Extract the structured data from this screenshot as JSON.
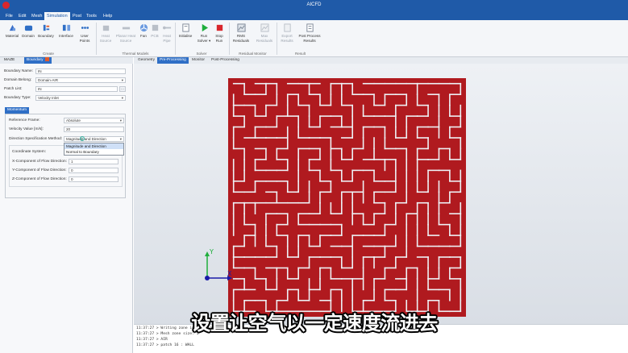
{
  "window": {
    "title": "AICFD"
  },
  "menu": [
    {
      "label": "File",
      "active": false
    },
    {
      "label": "Edit",
      "active": false
    },
    {
      "label": "Mesh",
      "active": false
    },
    {
      "label": "Simulation",
      "active": true
    },
    {
      "label": "Post",
      "active": false
    },
    {
      "label": "Tools",
      "active": false
    },
    {
      "label": "Help",
      "active": false
    }
  ],
  "ribbon": {
    "groups": [
      {
        "label": "Create",
        "buttons": [
          {
            "label": "Material",
            "icon": "material-icon",
            "enabled": true
          },
          {
            "label": "Domain",
            "icon": "domain-icon",
            "enabled": true
          },
          {
            "label": "Boundary",
            "icon": "boundary-icon",
            "enabled": true
          },
          {
            "label": "Interface",
            "icon": "interface-icon",
            "enabled": true
          },
          {
            "label": "User Points",
            "icon": "user-points-icon",
            "enabled": true
          }
        ]
      },
      {
        "label": "Thermal Models",
        "buttons": [
          {
            "label": "Heat Source",
            "icon": "heat-source-icon",
            "enabled": false
          },
          {
            "label": "Planar Heat Source",
            "icon": "planar-heat-source-icon",
            "enabled": false
          },
          {
            "label": "Fan",
            "icon": "fan-icon",
            "enabled": true
          },
          {
            "label": "PCB",
            "icon": "pcb-icon",
            "enabled": false
          },
          {
            "label": "Heat Pipe",
            "icon": "heat-pipe-icon",
            "enabled": false
          }
        ]
      },
      {
        "label": "Solver",
        "buttons": [
          {
            "label": "Initialise",
            "icon": "initialise-icon",
            "enabled": true
          },
          {
            "label": "Run Solver ▾",
            "icon": "run-solver-icon",
            "enabled": true
          },
          {
            "label": "Stop Run",
            "icon": "stop-run-icon",
            "enabled": true
          }
        ]
      },
      {
        "label": "Residual Monitor",
        "buttons": [
          {
            "label": "RMS Residuals",
            "icon": "rms-residuals-icon",
            "enabled": true
          },
          {
            "label": "Max Residuals",
            "icon": "max-residuals-icon",
            "enabled": false
          }
        ]
      },
      {
        "label": "Result",
        "buttons": [
          {
            "label": "Export Results",
            "icon": "export-results-icon",
            "enabled": false
          },
          {
            "label": "Post Process Results",
            "icon": "post-process-results-icon",
            "enabled": true
          }
        ]
      }
    ]
  },
  "left_panel": {
    "tabs": [
      {
        "label": "MAZE",
        "active": false
      },
      {
        "label": "Boundary",
        "active": true
      }
    ],
    "boundary_name": {
      "label": "Boundary Name:",
      "value": "IN"
    },
    "domain_belong": {
      "label": "Domain Belong:",
      "value": "Domain-AIR"
    },
    "patch_list": {
      "label": "Patch List:",
      "value": "IN",
      "button": "..."
    },
    "boundary_type": {
      "label": "Boundary Type:",
      "value": "Velocity Inlet"
    },
    "section_tab": "Momentum",
    "reference_frame": {
      "label": "Reference Frame:",
      "value": "Absolute"
    },
    "velocity_value": {
      "label": "Velocity Value [m/s]:",
      "value": "20"
    },
    "direction_method": {
      "label": "Direction Specification Method:",
      "value": "Magnitude and Direction",
      "options": [
        "Magnitude and Direction",
        "Normal to Boundary"
      ],
      "highlighted_index": 0
    },
    "coordinate_system": {
      "label": "Coordinate System:"
    },
    "x_component": {
      "label": "X-Component of Flow Direction:",
      "value": "1"
    },
    "y_component": {
      "label": "Y-Component of Flow Direction:",
      "value": "0"
    },
    "z_component": {
      "label": "Z-Component of Flow Direction:",
      "value": "0"
    }
  },
  "viewport": {
    "tabs": [
      {
        "label": "Geometry",
        "active": false
      },
      {
        "label": "Pre-Processing",
        "active": true
      },
      {
        "label": "Monitor",
        "active": false
      },
      {
        "label": "Post-Processing",
        "active": false
      }
    ],
    "maze_color": "#b01a1f",
    "maze_path_color": "#eef1f5",
    "axis": {
      "x_label": "X",
      "y_label": "Y",
      "x_color": "#1a1aa8",
      "y_color": "#1fae3c",
      "origin_color": "#1a1aa8"
    }
  },
  "console": {
    "lines": [
      "11:37:27 > Writing zone information file...",
      "11:37:27 >   Mesh zone size: 1",
      "11:37:27 >   AIR",
      "11:37:27 >   patch 16 : WALL"
    ]
  },
  "subtitle": "设置让空气以一定速度流进去",
  "colors": {
    "accent": "#1f5aa8",
    "tab_active": "#2f6fc6",
    "stop_red": "#d9262c",
    "run_green": "#1fae3c"
  }
}
